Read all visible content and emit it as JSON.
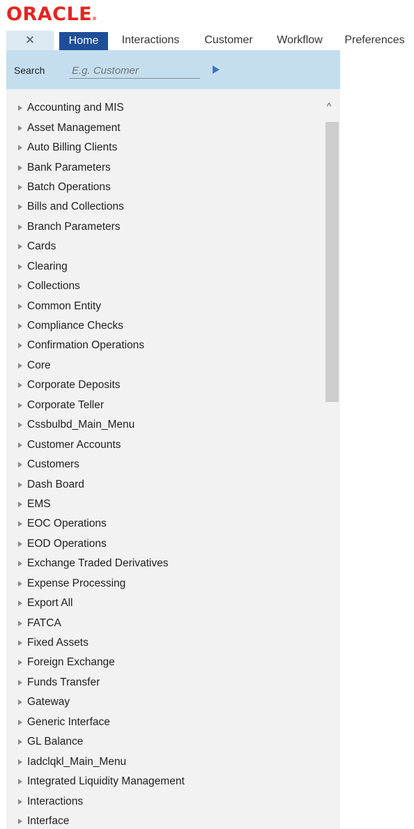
{
  "brand": {
    "logo_text": "ORACLE",
    "registered_mark": "®",
    "color": "#e3261f"
  },
  "colors": {
    "tab_active_bg": "#1f4f99",
    "search_bar_bg": "#c5deef"
  },
  "tabs": {
    "close_icon": "✕",
    "items": [
      "Home",
      "Interactions",
      "Customer",
      "Workflow",
      "Preferences"
    ],
    "active_index": 0
  },
  "search": {
    "label": "Search",
    "placeholder": "E.g. Customer",
    "value": ""
  },
  "scroll_up_icon": "^",
  "menu": {
    "items": [
      "Accounting and MIS",
      "Asset Management",
      "Auto Billing Clients",
      "Bank Parameters",
      "Batch Operations",
      "Bills and Collections",
      "Branch Parameters",
      "Cards",
      "Clearing",
      "Collections",
      "Common Entity",
      "Compliance Checks",
      "Confirmation Operations",
      "Core",
      "Corporate Deposits",
      "Corporate Teller",
      "Cssbulbd_Main_Menu",
      "Customer Accounts",
      "Customers",
      "Dash Board",
      "EMS",
      "EOC Operations",
      "EOD Operations",
      "Exchange Traded Derivatives",
      "Expense Processing",
      "Export All",
      "FATCA",
      "Fixed Assets",
      "Foreign Exchange",
      "Funds Transfer",
      "Gateway",
      "Generic Interface",
      "GL Balance",
      "Iadclqkl_Main_Menu",
      "Integrated Liquidity Management",
      "Interactions",
      "Interface"
    ]
  }
}
